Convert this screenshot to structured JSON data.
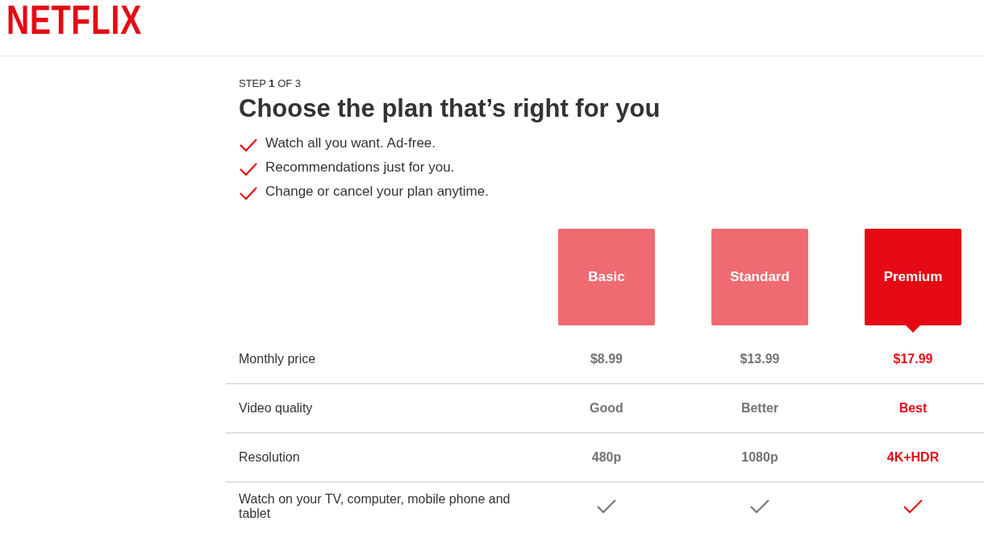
{
  "header": {
    "logo": "NETFLIX"
  },
  "step": "STEP **1** OF 3",
  "title": "Choose the plan that’s right for you",
  "benefits": [
    "Watch all you want. Ad-free.",
    "Recommendations just for you.",
    "Change or cancel your plan anytime."
  ],
  "plans": [
    {
      "name": "Basic",
      "selected": false
    },
    {
      "name": "Standard",
      "selected": false
    },
    {
      "name": "Premium",
      "selected": true
    }
  ],
  "rows": [
    {
      "label": "Monthly price",
      "kind": "text",
      "values": [
        "$8.99",
        "$13.99",
        "$17.99"
      ]
    },
    {
      "label": "Video quality",
      "kind": "text",
      "values": [
        "Good",
        "Better",
        "Best"
      ]
    },
    {
      "label": "Resolution",
      "kind": "text",
      "values": [
        "480p",
        "1080p",
        "4K+HDR"
      ]
    },
    {
      "label": "Watch on your TV, computer, mobile phone and tablet",
      "kind": "check",
      "values": [
        true,
        true,
        true
      ]
    }
  ]
}
